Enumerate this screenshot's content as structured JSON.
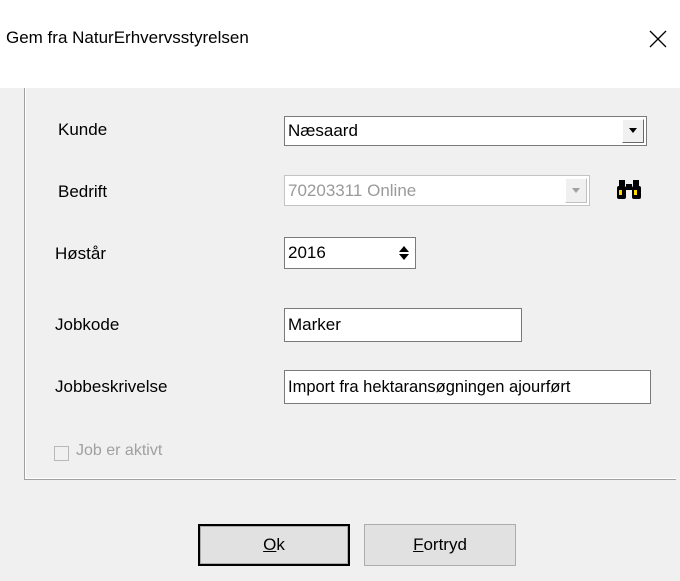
{
  "window": {
    "title": "Gem fra NaturErhvervsstyrelsen",
    "close_icon": "close-icon"
  },
  "form": {
    "kunde": {
      "label": "Kunde",
      "value": "Næsaard"
    },
    "bedrift": {
      "label": "Bedrift",
      "value": "70203311 Online",
      "find_icon": "binoculars-icon"
    },
    "hostar": {
      "label": "Høstår",
      "value": "2016"
    },
    "jobkode": {
      "label": "Jobkode",
      "value": "Marker"
    },
    "jobbeskrivelse": {
      "label": "Jobbeskrivelse",
      "value": "Import fra hektaransøgningen ajourført"
    },
    "job_aktivt": {
      "label": "Job er aktivt",
      "checked": false
    }
  },
  "buttons": {
    "ok": {
      "mnemonic": "O",
      "rest": "k"
    },
    "fortryd": {
      "mnemonic": "F",
      "rest": "ortryd"
    }
  }
}
